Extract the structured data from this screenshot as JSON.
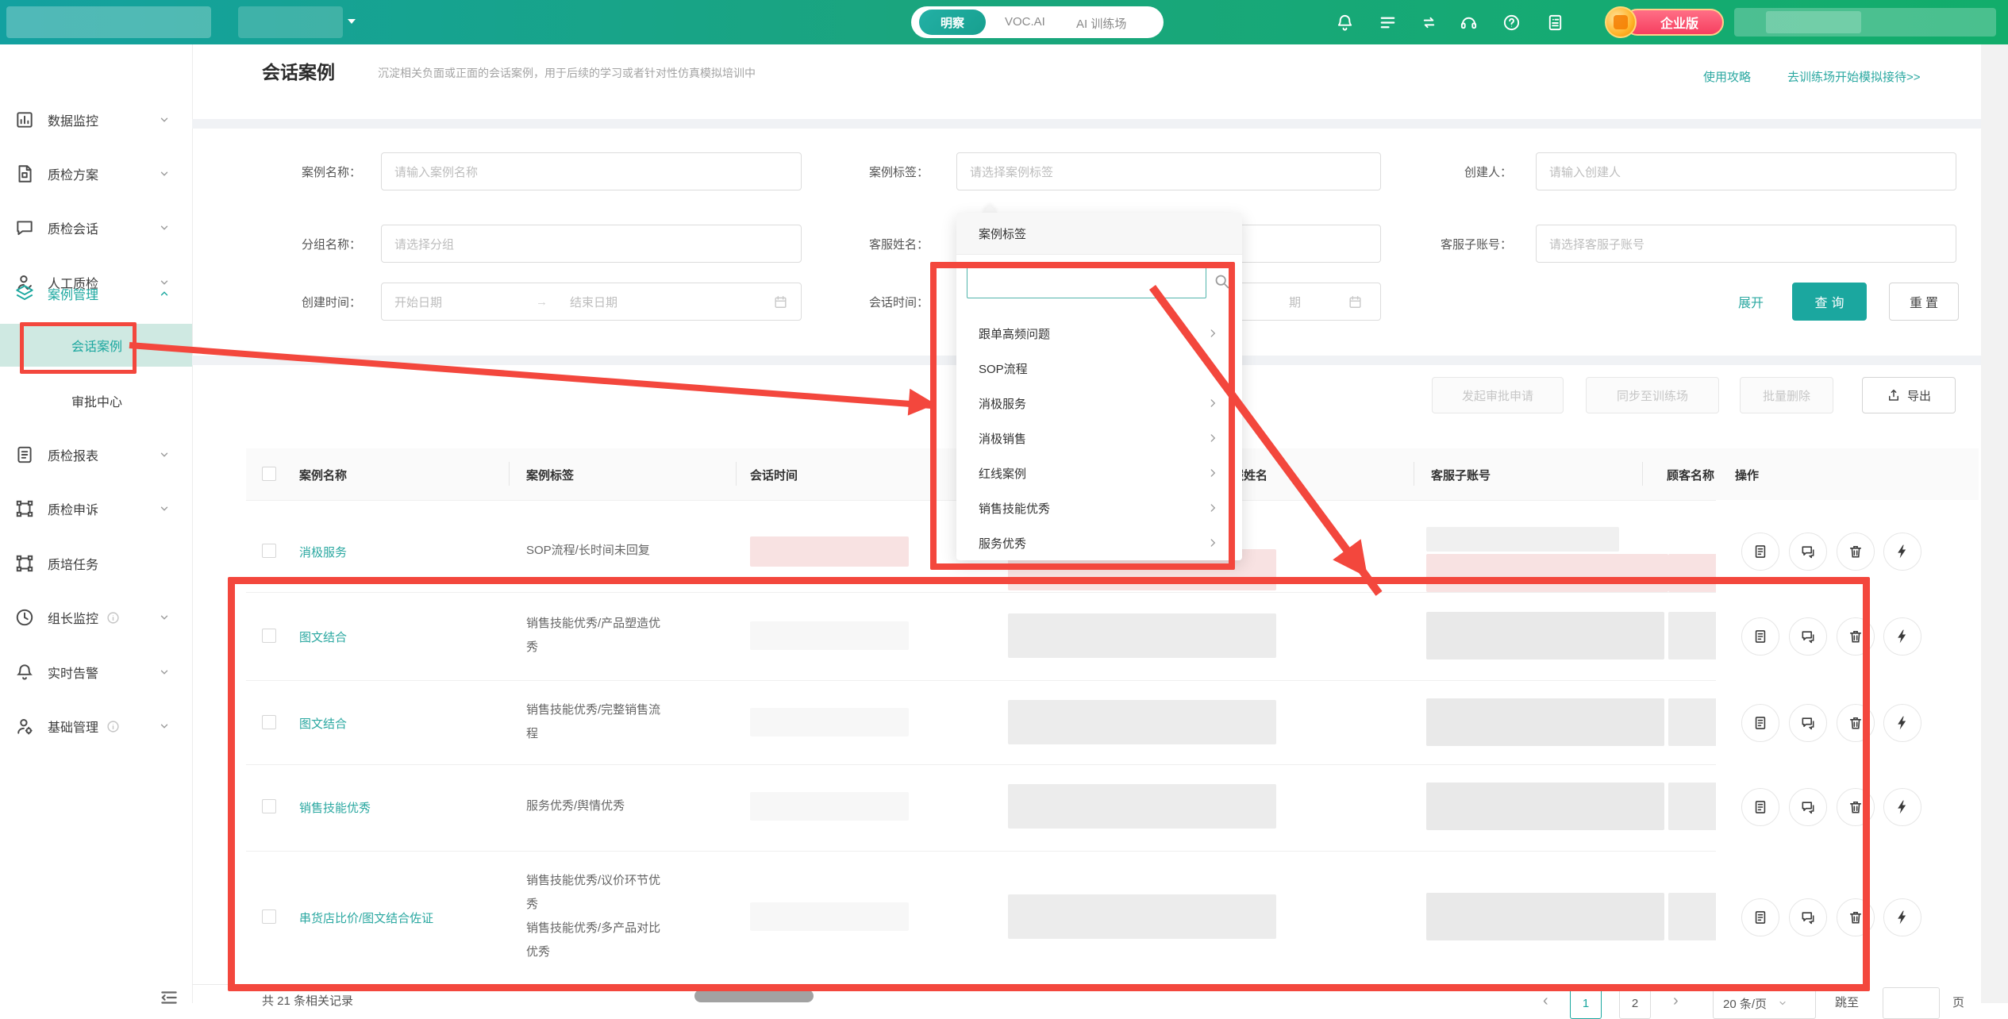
{
  "colors": {
    "accent": "#1ba79f",
    "link_teal": "#2ba8a1",
    "annotation_red": "#f3473d"
  },
  "topbar": {
    "tabs": [
      {
        "label": "明察"
      },
      {
        "label": "VOC.AI"
      },
      {
        "label": "AI 训练场"
      }
    ],
    "badge": "企业版"
  },
  "sidebar": {
    "items": [
      {
        "label": "数据监控"
      },
      {
        "label": "质检方案"
      },
      {
        "label": "质检会话"
      },
      {
        "label": "人工质检"
      },
      {
        "label": "案例管理"
      },
      {
        "label": "质检报表"
      },
      {
        "label": "质检申诉"
      },
      {
        "label": "质培任务"
      },
      {
        "label": "组长监控"
      },
      {
        "label": "实时告警"
      },
      {
        "label": "基础管理"
      }
    ],
    "subitems": [
      {
        "label": "会话案例"
      },
      {
        "label": "审批中心"
      }
    ]
  },
  "page": {
    "title": "会话案例",
    "description": "沉淀相关负面或正面的会话案例，用于后续的学习或者针对性仿真模拟培训中",
    "guide_link": "使用攻略",
    "training_link": "去训练场开始模拟接待>>"
  },
  "filters": {
    "case_name": {
      "label": "案例名称：",
      "placeholder": "请输入案例名称"
    },
    "case_tag": {
      "label": "案例标签：",
      "placeholder": "请选择案例标签"
    },
    "creator": {
      "label": "创建人：",
      "placeholder": "请输入创建人"
    },
    "group_name": {
      "label": "分组名称：",
      "placeholder": "请选择分组"
    },
    "agent_name": {
      "label": "客服姓名："
    },
    "agent_account": {
      "label": "客服子账号：",
      "placeholder": "请选择客服子账号"
    },
    "create_time": {
      "label": "创建时间：",
      "start_placeholder": "开始日期",
      "arrow": "→",
      "end_placeholder": "结束日期"
    },
    "session_time": {
      "label": "会话时间：",
      "visible_fragment": "期"
    },
    "expand_link": "展开",
    "search_button": "查询",
    "reset_button": "重置"
  },
  "tag_dropdown": {
    "title": "案例标签",
    "options": [
      "跟单高频问题",
      "SOP流程",
      "消极服务",
      "消极销售",
      "红线案例",
      "销售技能优秀",
      "服务优秀"
    ]
  },
  "toolbar": {
    "approve": "发起审批申请",
    "sync": "同步至训练场",
    "batch_delete": "批量删除",
    "export": "导出"
  },
  "table": {
    "headers": [
      "案例名称",
      "案例标签",
      "会话时间",
      "客服姓名",
      "客服子账号",
      "顾客名称",
      "操作"
    ],
    "rows": [
      {
        "name": "消极服务",
        "tags": "SOP流程/长时间未回复"
      },
      {
        "name": "图文结合",
        "tags": "销售技能优秀/产品塑造优\n秀"
      },
      {
        "name": "图文结合",
        "tags": "销售技能优秀/完整销售流\n程"
      },
      {
        "name": "销售技能优秀",
        "tags": "服务优秀/舆情优秀"
      },
      {
        "name": "串货店比价/图文结合佐证",
        "tags": "销售技能优秀/议价环节优\n秀\n销售技能优秀/多产品对比\n优秀"
      }
    ]
  },
  "pagination": {
    "total": "共 21 条相关记录",
    "prev": "‹",
    "pages": [
      "1",
      "2"
    ],
    "next": "›",
    "page_size": "20 条/页",
    "jump_label": "跳至",
    "jump_unit": "页"
  }
}
